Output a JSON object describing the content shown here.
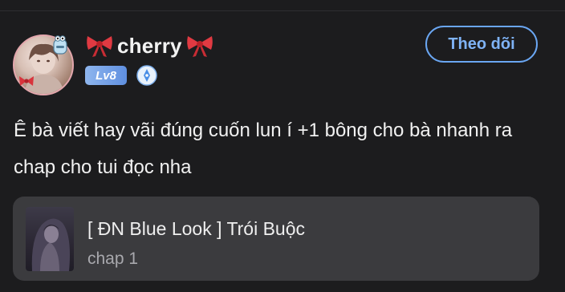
{
  "user": {
    "name": "cherry",
    "level": "Lv8",
    "left_decoration": "ribbon-bow-icon",
    "right_decoration": "ribbon-bow-icon"
  },
  "follow_button": {
    "label": "Theo dõi"
  },
  "comment": {
    "text": "Ê bà viết hay vãi đúng cuốn lun í +1 bông cho bà nhanh ra chap cho tui đọc nha"
  },
  "story": {
    "title": "[ ĐN Blue Look ] Trói Buộc",
    "chapter": "chap 1"
  },
  "colors": {
    "background": "#1c1c1e",
    "accent_blue": "#6aa6f2",
    "level_badge": "#7aa5ea",
    "card": "#3b3b3e",
    "bow_red": "#d8343c"
  }
}
